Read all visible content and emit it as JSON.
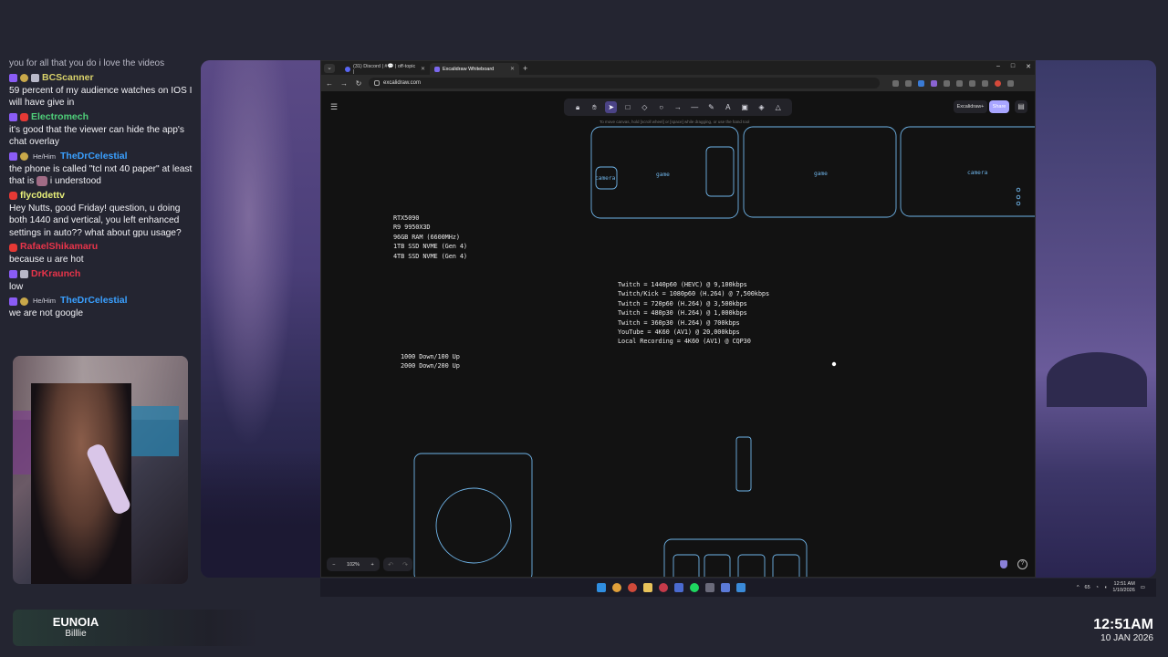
{
  "chat": {
    "cut_line": "you for all that you do i love the videos",
    "messages": [
      {
        "user": "BCScanner",
        "color": "#d8d16a",
        "pronoun": "",
        "text": "59 percent of my audience watches on IOS I will have give in"
      },
      {
        "user": "Electromech",
        "color": "#4fd07a",
        "pronoun": "",
        "text": "it's good that the viewer can hide the app's chat overlay"
      },
      {
        "user": "TheDrCelestial",
        "color": "#3aa0ff",
        "pronoun": "He/Him",
        "text": "the phone is called \"tcl nxt 40 paper\" at least that is",
        "text_after": "i understood"
      },
      {
        "user": "flyc0dettv",
        "color": "#e9f07a",
        "pronoun": "",
        "text": "Hey Nutts, good Friday! question, u doing both 1440 and vertical, you left enhanced settings in auto?? what about gpu usage?"
      },
      {
        "user": "RafaelShikamaru",
        "color": "#e8344a",
        "pronoun": "",
        "text": "because u are hot"
      },
      {
        "user": "DrKraunch",
        "color": "#e8344a",
        "pronoun": "",
        "text": "low"
      },
      {
        "user": "TheDrCelestial",
        "color": "#3aa0ff",
        "pronoun": "He/Him",
        "text": "we are not google"
      }
    ]
  },
  "music": {
    "song": "EUNOIA",
    "artist": "Billlie"
  },
  "clock": {
    "time": "12:51AM",
    "date": "10 JAN 2026"
  },
  "browser": {
    "tabs": [
      {
        "label": "(31) Discord | #💬 | off-topic |"
      },
      {
        "label": "Excalidraw Whiteboard"
      }
    ],
    "url": "excalidraw.com",
    "window_controls": [
      "–",
      "□",
      "✕"
    ]
  },
  "excalidraw": {
    "hint": "To move canvas, hold [scroll wheel] or [space] while dragging, or use the hand tool",
    "plus_label": "Excalidraw+",
    "share_label": "Share",
    "zoom": "102%",
    "specs": [
      "RTX5090",
      "R9 9950X3D",
      "96GB RAM (6600MHz)",
      "1TB SSD NVME (Gen 4)",
      "4TB SSD NVME (Gen 4)"
    ],
    "speeds": [
      "1000 Down/100 Up",
      "2000 Down/200 Up"
    ],
    "rates": [
      "Twitch = 1440p60 (HEVC) @ 9,100kbps",
      "Twitch/Kick = 1080p60 (H.264) @ 7,500kbps",
      "Twitch = 720p60 (H.264) @ 3,500kbps",
      "Twitch = 480p30 (H.264) @ 1,000kbps",
      "Twitch = 360p30 (H.264) @ 700kbps",
      "YouTube = 4K60 (AV1) @ 20,000kbps",
      "Local Recording = 4K60 (AV1) @ CQP30"
    ],
    "labels": {
      "camera": "camera",
      "game": "game"
    }
  },
  "taskbar": {
    "tray_number": "65",
    "time": "12:51 AM",
    "date": "1/10/2026"
  }
}
